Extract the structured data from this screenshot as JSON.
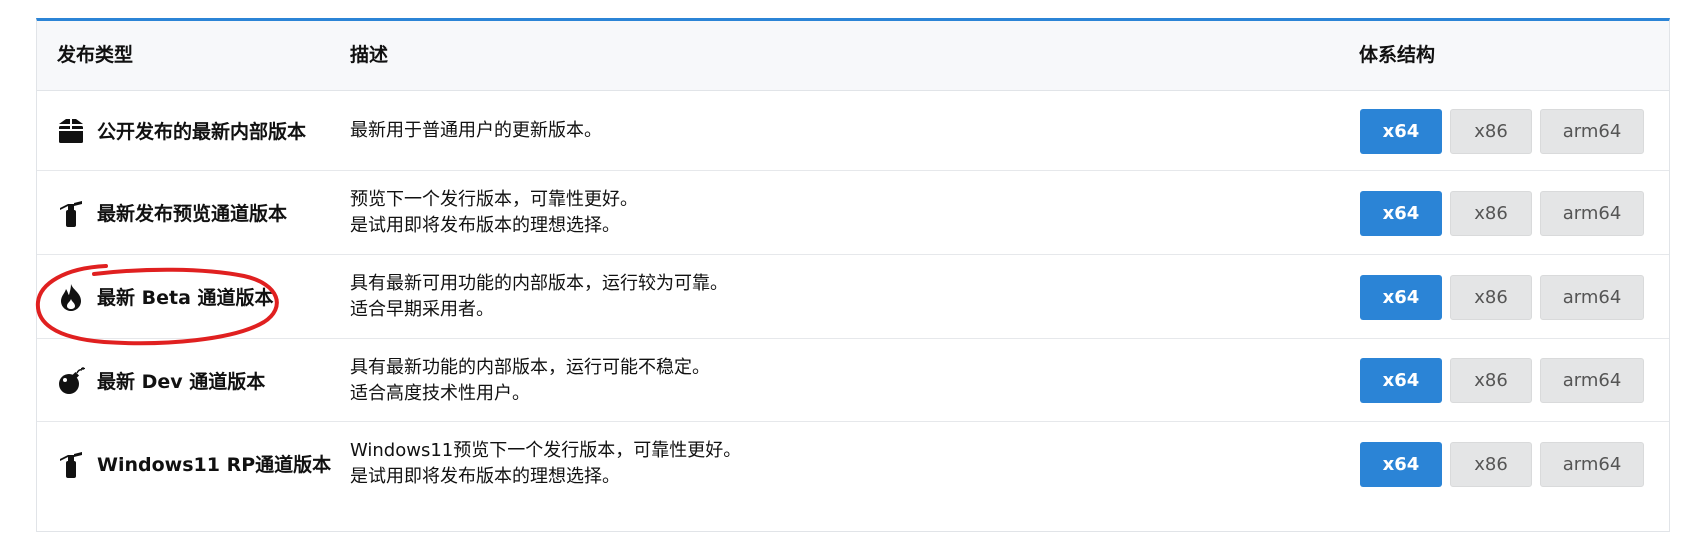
{
  "header": {
    "type_label": "发布类型",
    "desc_label": "描述",
    "arch_label": "体系结构"
  },
  "rows": [
    {
      "icon": "package-icon",
      "name": "公开发布的最新内部版本",
      "desc_line1": "最新用于普通用户的更新版本。",
      "desc_line2": "",
      "arch": [
        "x64",
        "x86",
        "arm64"
      ]
    },
    {
      "icon": "fire-extinguisher-icon",
      "name": "最新发布预览通道版本",
      "desc_line1": "预览下一个发行版本，可靠性更好。",
      "desc_line2": "是试用即将发布版本的理想选择。",
      "arch": [
        "x64",
        "x86",
        "arm64"
      ]
    },
    {
      "icon": "flame-icon",
      "name": "最新 Beta 通道版本",
      "desc_line1": "具有最新可用功能的内部版本，运行较为可靠。",
      "desc_line2": "适合早期采用者。",
      "arch": [
        "x64",
        "x86",
        "arm64"
      ]
    },
    {
      "icon": "bomb-icon",
      "name": "最新 Dev 通道版本",
      "desc_line1": "具有最新功能的内部版本，运行可能不稳定。",
      "desc_line2": "适合高度技术性用户。",
      "arch": [
        "x64",
        "x86",
        "arm64"
      ]
    },
    {
      "icon": "fire-extinguisher-icon",
      "name": "Windows11 RP通道版本",
      "desc_line1": "Windows11预览下一个发行版本，可靠性更好。",
      "desc_line2": "是试用即将发布版本的理想选择。",
      "arch": [
        "x64",
        "x86",
        "arm64"
      ]
    }
  ],
  "colors": {
    "accent": "#2b84d6",
    "secondary_button": "#e4e5e6",
    "annotation": "#e02020"
  }
}
